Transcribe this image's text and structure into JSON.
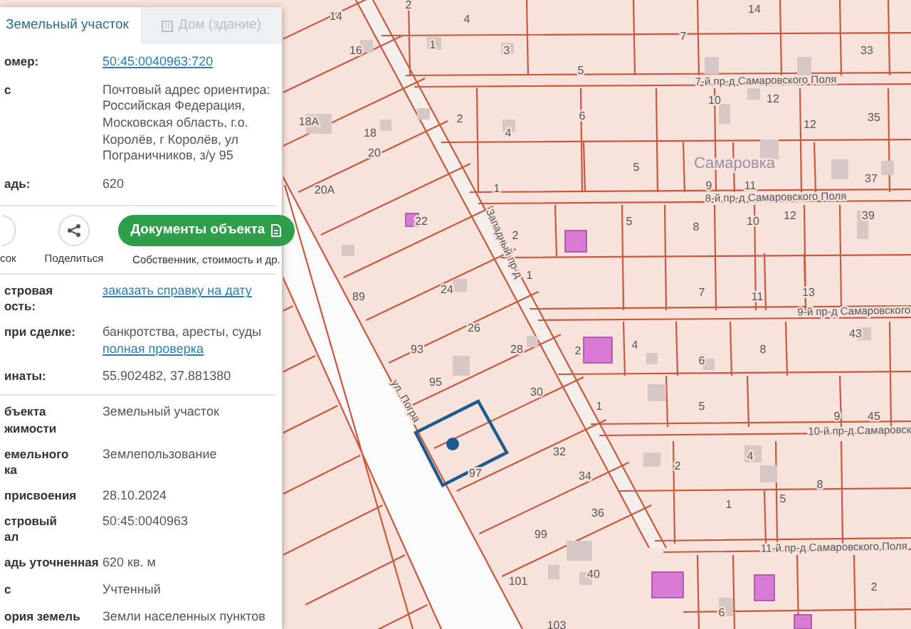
{
  "tabs": [
    {
      "label": "Земельный участок",
      "selected": true
    },
    {
      "label": "Дом (здание)",
      "selected": false
    }
  ],
  "summary": [
    {
      "label": "омер:",
      "value": "50:45:0040963:720",
      "kind": "link"
    },
    {
      "label": "с",
      "value": "Почтовый адрес ориентира: Российская Федерация, Московская область, г.о. Королёв, г Королёв, ул Пограничников, з/у 95",
      "kind": "text"
    },
    {
      "label": "адь:",
      "value": "620",
      "kind": "text"
    }
  ],
  "actions": [
    {
      "label": "сок",
      "kind": "partial"
    },
    {
      "label": "Поделиться",
      "kind": "share"
    }
  ],
  "documents_button": {
    "label": "Документы объекта",
    "caption": "Собственник, стоимость и др."
  },
  "checks": [
    {
      "label": "стровая\nость:",
      "lines": [
        {
          "text": "заказать справку на дату",
          "kind": "link"
        }
      ]
    },
    {
      "label": "при сделке:",
      "lines": [
        {
          "text": "банкротства, аресты, суды",
          "kind": "text"
        },
        {
          "text": "полная проверка",
          "kind": "link"
        }
      ]
    },
    {
      "label": "инаты:",
      "lines": [
        {
          "text": "55.902482, 37.881380",
          "kind": "text"
        }
      ]
    }
  ],
  "details": [
    {
      "label": "бъекта\nжимости",
      "value": "Земельный участок"
    },
    {
      "label": "емельного\nка",
      "value": "Землепользование"
    },
    {
      "label": "присвоения",
      "value": "28.10.2024"
    },
    {
      "label": "стровый\nал",
      "value": "50:45:0040963"
    },
    {
      "label": "адь уточненная",
      "value": "620 кв. м"
    },
    {
      "label": "с",
      "value": "Учтенный"
    },
    {
      "label": "ория земель",
      "value": "Земли населенных пунктов"
    }
  ],
  "map": {
    "labels": [
      {
        "text": "14",
        "kind": "lot"
      },
      {
        "text": "2",
        "kind": "lot"
      },
      {
        "text": "4",
        "kind": "lot"
      },
      {
        "text": "14",
        "kind": "lot"
      },
      {
        "text": "1",
        "kind": "lot"
      },
      {
        "text": "3",
        "kind": "lot"
      },
      {
        "text": "7",
        "kind": "lot"
      },
      {
        "text": "16",
        "kind": "lot"
      },
      {
        "text": "5",
        "kind": "lot"
      },
      {
        "text": "33",
        "kind": "lot"
      },
      {
        "text": "7-й пр-д Самаровского Поля",
        "kind": "street"
      },
      {
        "text": "18А",
        "kind": "lot"
      },
      {
        "text": "18",
        "kind": "lot"
      },
      {
        "text": "2",
        "kind": "lot"
      },
      {
        "text": "4",
        "kind": "lot"
      },
      {
        "text": "6",
        "kind": "lot"
      },
      {
        "text": "10",
        "kind": "lot"
      },
      {
        "text": "12",
        "kind": "lot"
      },
      {
        "text": "12",
        "kind": "lot"
      },
      {
        "text": "35",
        "kind": "lot"
      },
      {
        "text": "20",
        "kind": "lot"
      },
      {
        "text": "Самаровка",
        "kind": "place"
      },
      {
        "text": "5",
        "kind": "lot"
      },
      {
        "text": "1",
        "kind": "lot"
      },
      {
        "text": "9",
        "kind": "lot"
      },
      {
        "text": "11",
        "kind": "lot"
      },
      {
        "text": "37",
        "kind": "lot"
      },
      {
        "text": "20А",
        "kind": "lot"
      },
      {
        "text": "8-й пр-д Самаровского Поля",
        "kind": "street"
      },
      {
        "text": "22",
        "kind": "lot"
      },
      {
        "text": "2",
        "kind": "lot"
      },
      {
        "text": "5",
        "kind": "lot"
      },
      {
        "text": "8",
        "kind": "lot"
      },
      {
        "text": "10",
        "kind": "lot"
      },
      {
        "text": "12",
        "kind": "lot"
      },
      {
        "text": "39",
        "kind": "lot"
      },
      {
        "text": "Западный пр-д",
        "kind": "street"
      },
      {
        "text": "24",
        "kind": "lot"
      },
      {
        "text": "89",
        "kind": "lot"
      },
      {
        "text": "1",
        "kind": "lot"
      },
      {
        "text": "7",
        "kind": "lot"
      },
      {
        "text": "11",
        "kind": "lot"
      },
      {
        "text": "13",
        "kind": "lot"
      },
      {
        "text": "9-й пр-д Самаровского",
        "kind": "street"
      },
      {
        "text": "93",
        "kind": "lot"
      },
      {
        "text": "26",
        "kind": "lot"
      },
      {
        "text": "28",
        "kind": "lot"
      },
      {
        "text": "2",
        "kind": "lot"
      },
      {
        "text": "4",
        "kind": "lot"
      },
      {
        "text": "6",
        "kind": "lot"
      },
      {
        "text": "8",
        "kind": "lot"
      },
      {
        "text": "43",
        "kind": "lot"
      },
      {
        "text": "95",
        "kind": "lot"
      },
      {
        "text": "30",
        "kind": "lot"
      },
      {
        "text": "1",
        "kind": "lot"
      },
      {
        "text": "5",
        "kind": "lot"
      },
      {
        "text": "9",
        "kind": "lot"
      },
      {
        "text": "45",
        "kind": "lot"
      },
      {
        "text": "ул. Погра",
        "kind": "street"
      },
      {
        "text": "10-й пр-д Самаровск",
        "kind": "street"
      },
      {
        "text": "32",
        "kind": "lot"
      },
      {
        "text": "2",
        "kind": "lot"
      },
      {
        "text": "4",
        "kind": "lot"
      },
      {
        "text": "97",
        "kind": "lot"
      },
      {
        "text": "34",
        "kind": "lot"
      },
      {
        "text": "8",
        "kind": "lot"
      },
      {
        "text": "1",
        "kind": "lot"
      },
      {
        "text": "5",
        "kind": "lot"
      },
      {
        "text": "36",
        "kind": "lot"
      },
      {
        "text": "99",
        "kind": "lot"
      },
      {
        "text": "11-й пр-д Самаровского Поля",
        "kind": "street"
      },
      {
        "text": "101",
        "kind": "lot"
      },
      {
        "text": "40",
        "kind": "lot"
      },
      {
        "text": "2",
        "kind": "lot"
      },
      {
        "text": "6",
        "kind": "lot"
      },
      {
        "text": "103",
        "kind": "lot"
      }
    ]
  }
}
